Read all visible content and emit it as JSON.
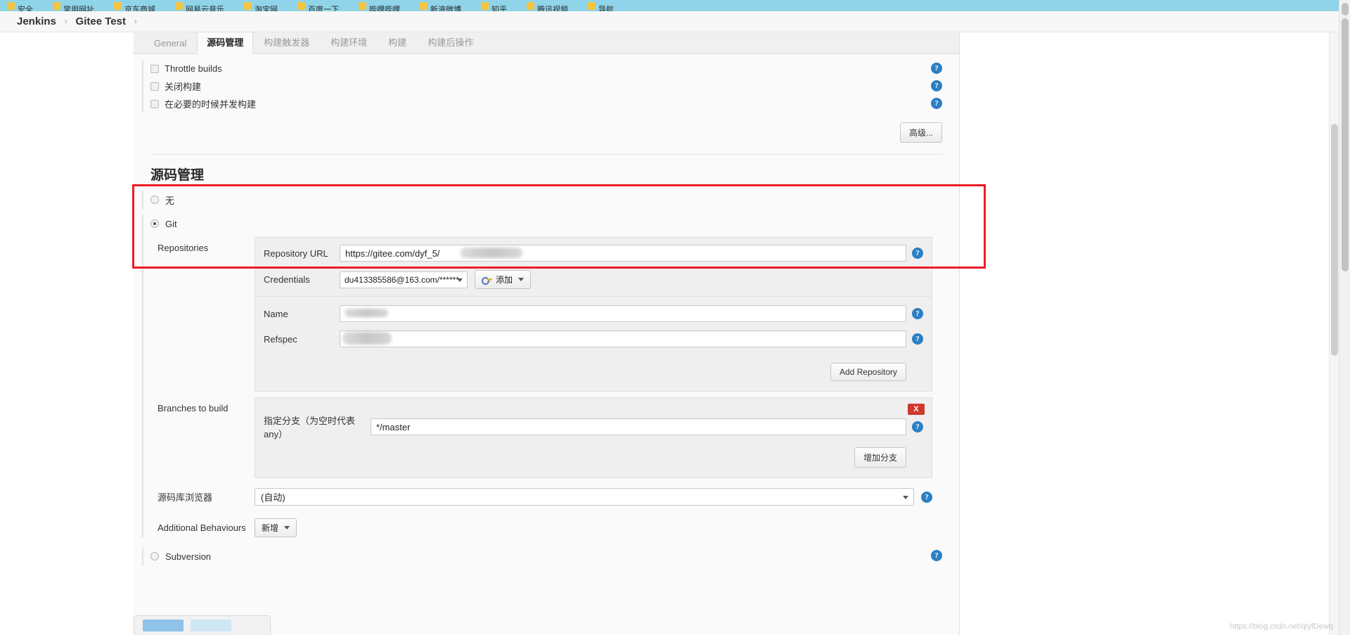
{
  "browser": {
    "bookmarks": [
      {
        "label": "安全"
      },
      {
        "label": "常用网址"
      },
      {
        "label": "京东商城"
      },
      {
        "label": "网易云音乐"
      },
      {
        "label": "淘宝网"
      },
      {
        "label": "百度一下"
      },
      {
        "label": "哔哩哔哩"
      },
      {
        "label": "新浪微博"
      },
      {
        "label": "知乎"
      },
      {
        "label": "腾讯视频"
      },
      {
        "label": "导航"
      }
    ]
  },
  "breadcrumb": {
    "root": "Jenkins",
    "project": "Gitee Test",
    "separator": "›"
  },
  "tabs": [
    {
      "label": "General",
      "active": false
    },
    {
      "label": "源码管理",
      "active": true
    },
    {
      "label": "构建触发器",
      "active": false
    },
    {
      "label": "构建环境",
      "active": false
    },
    {
      "label": "构建",
      "active": false
    },
    {
      "label": "构建后操作",
      "active": false
    }
  ],
  "top_options": {
    "checkboxes": [
      {
        "label": "Throttle builds",
        "checked": false
      },
      {
        "label": "关闭构建",
        "checked": false
      },
      {
        "label": "在必要的时候并发构建",
        "checked": false
      }
    ],
    "advanced_button": "高级..."
  },
  "scm": {
    "section_title": "源码管理",
    "radios": [
      {
        "label": "无",
        "selected": false
      },
      {
        "label": "Git",
        "selected": true
      },
      {
        "label": "Subversion",
        "selected": false
      }
    ],
    "repositories": {
      "label": "Repositories",
      "url_label": "Repository URL",
      "url_value": "https://gitee.com/dyf_5/",
      "url_redacted": true,
      "credentials_label": "Credentials",
      "credentials_value": "du413385586@163.com/******",
      "add_button": "添加",
      "name_label": "Name",
      "name_value": "",
      "name_redacted": true,
      "refspec_label": "Refspec",
      "refspec_value": "",
      "refspec_redacted": true,
      "add_repository_button": "Add Repository"
    },
    "branches": {
      "label": "Branches to build",
      "branch_label": "指定分支（为空时代表any）",
      "branch_value": "*/master",
      "delete_button": "X",
      "add_branch_button": "增加分支"
    },
    "browser": {
      "label": "源码库浏览器",
      "value": "(自动)"
    },
    "additional": {
      "label": "Additional Behaviours",
      "add_button": "新增"
    }
  },
  "watermark": "https://blog.csdn.net/qlyfDewq"
}
